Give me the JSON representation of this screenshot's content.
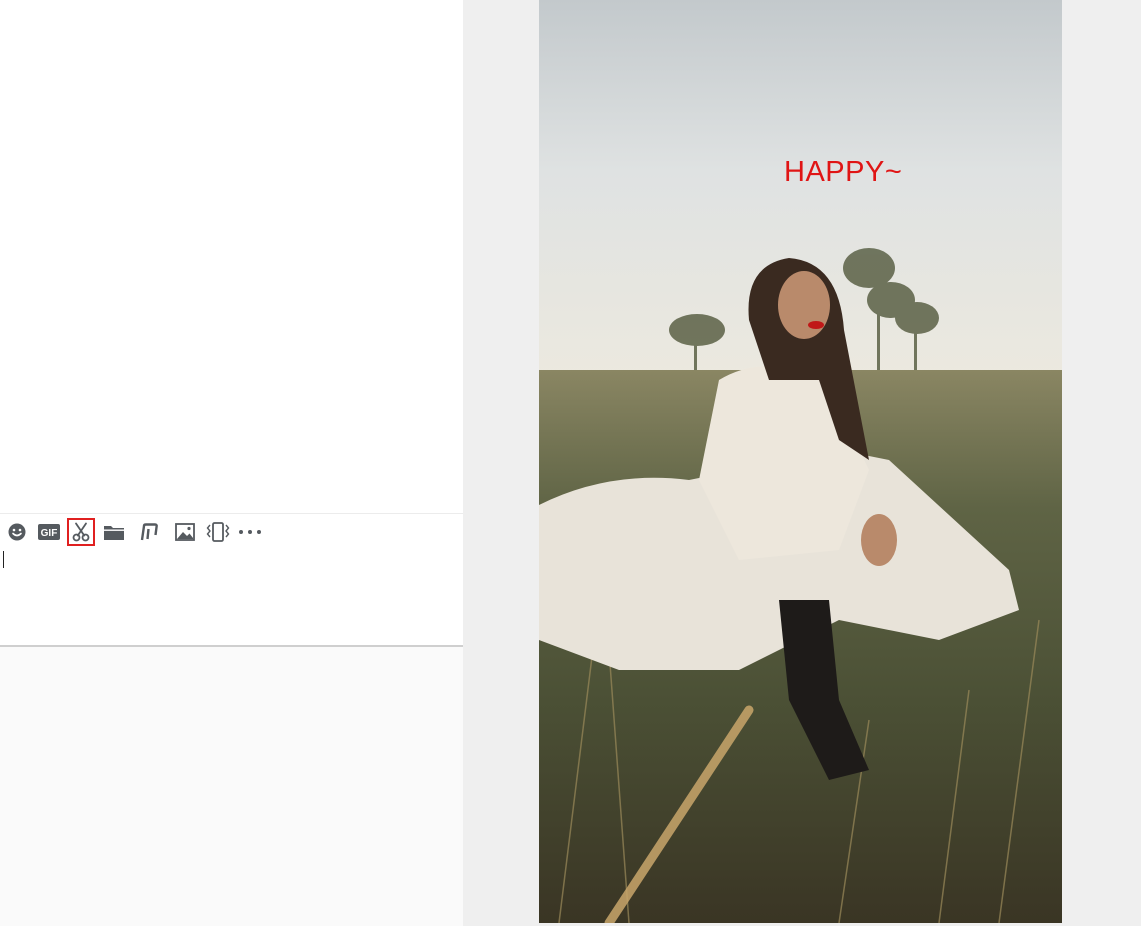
{
  "toolbar": {
    "tools": [
      {
        "icon": "emoji-icon",
        "active": false
      },
      {
        "icon": "gif-icon",
        "label": "GIF",
        "active": false
      },
      {
        "icon": "scissors-icon",
        "active": true
      },
      {
        "icon": "folder-icon",
        "active": false
      },
      {
        "icon": "music-note-icon",
        "active": false
      },
      {
        "icon": "image-icon",
        "active": false
      },
      {
        "icon": "shake-icon",
        "active": false
      },
      {
        "icon": "more-icon",
        "active": false
      }
    ],
    "active_color": "#e02020",
    "icon_color": "#555a5f"
  },
  "input": {
    "value": ""
  },
  "preview": {
    "overlay_text": "HAPPY~",
    "overlay_color": "#e01515",
    "image_subject": "photo-woman-in-white-sitting-in-grass"
  }
}
